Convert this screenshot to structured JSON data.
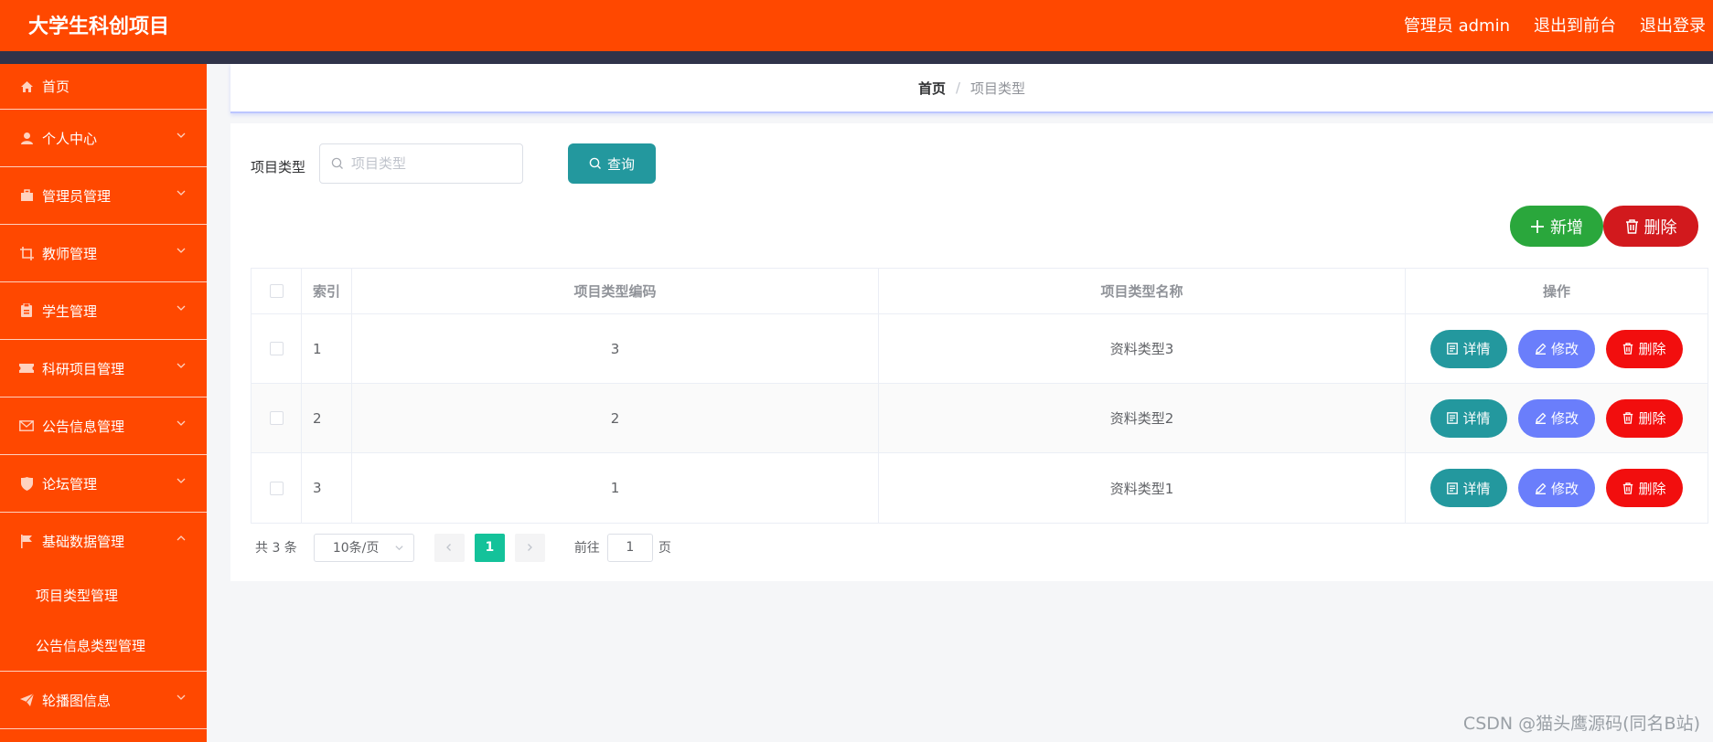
{
  "header": {
    "brand": "大学生科创项目",
    "user_label": "管理员 admin",
    "to_frontend": "退出到前台",
    "logout": "退出登录"
  },
  "sidebar": {
    "items": [
      {
        "label": "首页",
        "icon": "home-icon"
      },
      {
        "label": "个人中心",
        "icon": "user-icon"
      },
      {
        "label": "管理员管理",
        "icon": "briefcase-icon"
      },
      {
        "label": "教师管理",
        "icon": "crop-icon"
      },
      {
        "label": "学生管理",
        "icon": "clipboard-icon"
      },
      {
        "label": "科研项目管理",
        "icon": "ticket-icon"
      },
      {
        "label": "公告信息管理",
        "icon": "mail-icon"
      },
      {
        "label": "论坛管理",
        "icon": "shield-icon"
      },
      {
        "label": "基础数据管理",
        "icon": "flag-icon"
      }
    ],
    "sub_items": [
      {
        "label": "项目类型管理"
      },
      {
        "label": "公告信息类型管理"
      }
    ],
    "last_item": {
      "label": "轮播图信息",
      "icon": "send-icon"
    }
  },
  "breadcrumb": {
    "home": "首页",
    "separator": "/",
    "current": "项目类型"
  },
  "search": {
    "label": "项目类型",
    "placeholder": "项目类型",
    "value": "",
    "button": "查询"
  },
  "actions": {
    "add": "新增",
    "delete": "删除"
  },
  "table": {
    "headers": {
      "index": "索引",
      "code": "项目类型编码",
      "name": "项目类型名称",
      "ops": "操作"
    },
    "rows": [
      {
        "index": "1",
        "code": "3",
        "name": "资料类型3"
      },
      {
        "index": "2",
        "code": "2",
        "name": "资料类型2"
      },
      {
        "index": "3",
        "code": "1",
        "name": "资料类型1"
      }
    ],
    "row_buttons": {
      "detail": "详情",
      "edit": "修改",
      "delete": "删除"
    }
  },
  "pagination": {
    "total": "共 3 条",
    "page_size": "10条/页",
    "current_page": "1",
    "goto_label": "前往",
    "goto_value": "1",
    "goto_unit": "页"
  },
  "watermark": "CSDN @猫头鹰源码(同名B站)",
  "colors": {
    "brand": "#ff4800",
    "nav_line": "#303349",
    "query": "#23989e",
    "add": "#2aa73c",
    "danger": "#d2191d",
    "edit": "#6a7efb",
    "delete_row": "#f20e0e",
    "page_active": "#14c29a"
  }
}
